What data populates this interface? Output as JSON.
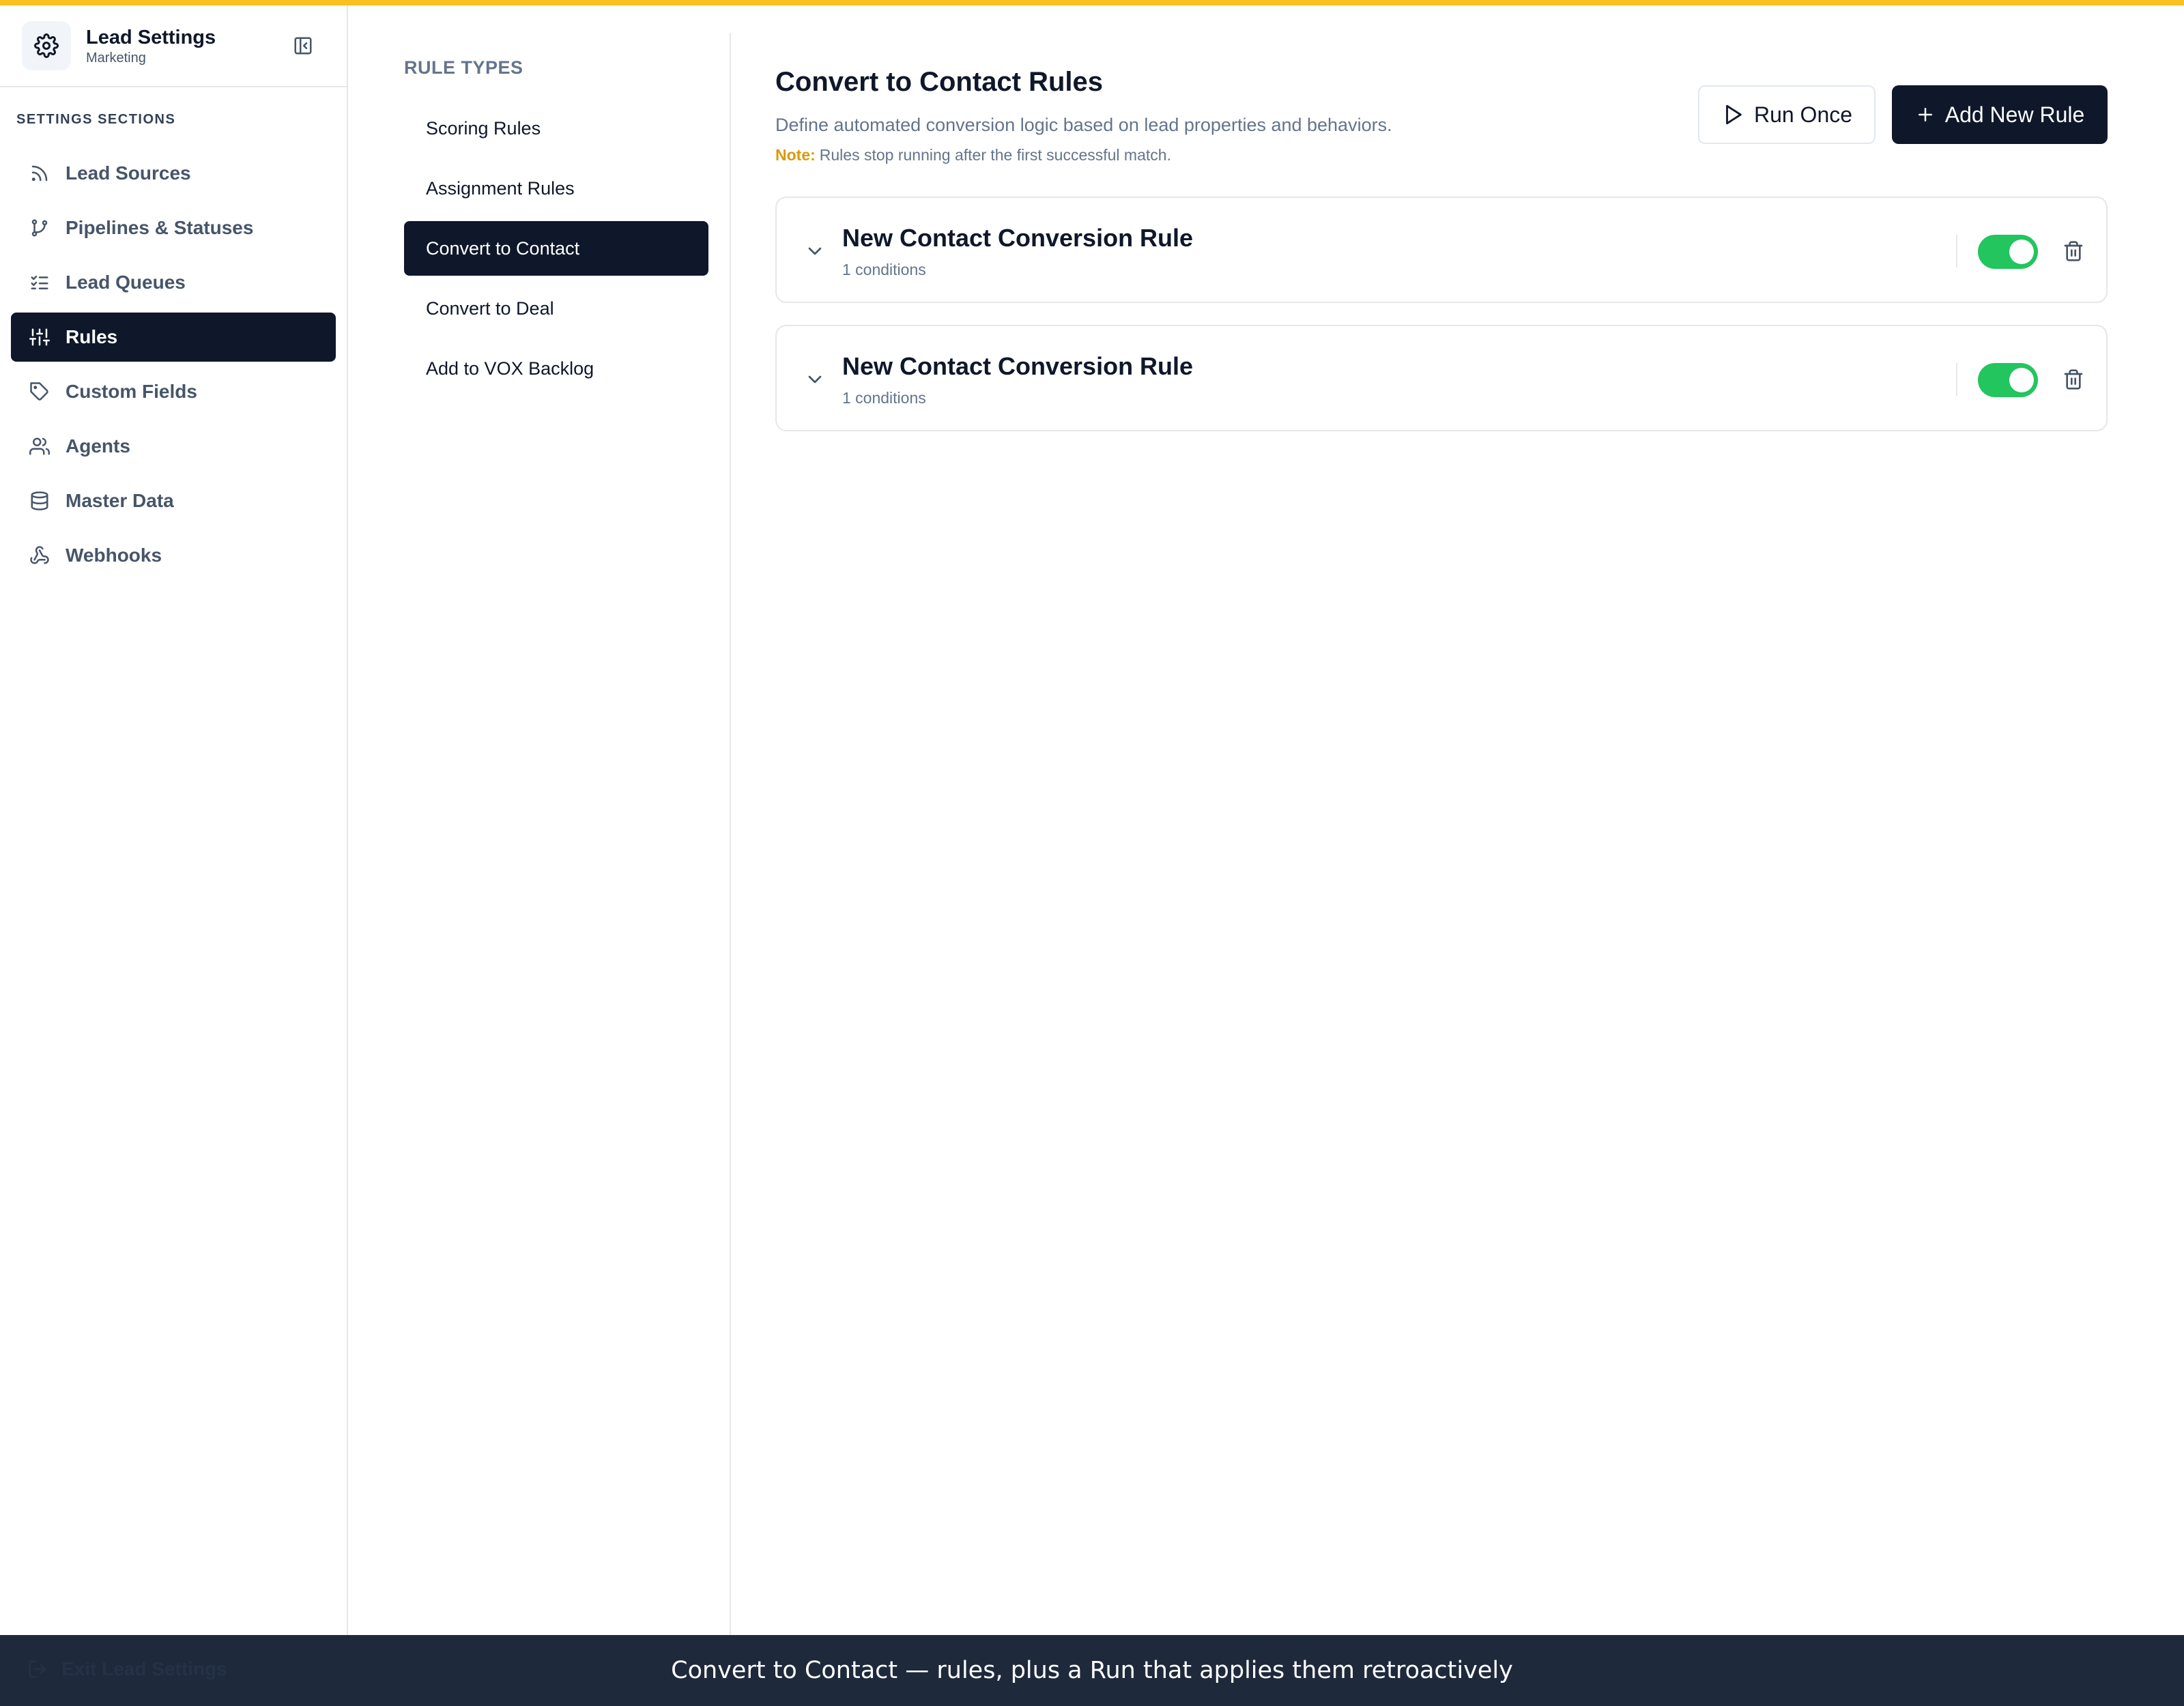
{
  "app": {
    "title": "Lead Settings",
    "subtitle": "Marketing"
  },
  "sidebar": {
    "section_label": "SETTINGS SECTIONS",
    "items": [
      {
        "label": "Lead Sources",
        "icon": "rss-icon"
      },
      {
        "label": "Pipelines & Statuses",
        "icon": "git-branch-icon"
      },
      {
        "label": "Lead Queues",
        "icon": "list-checks-icon"
      },
      {
        "label": "Rules",
        "icon": "sliders-icon",
        "active": true
      },
      {
        "label": "Custom Fields",
        "icon": "tag-icon"
      },
      {
        "label": "Agents",
        "icon": "users-icon"
      },
      {
        "label": "Master Data",
        "icon": "database-icon"
      },
      {
        "label": "Webhooks",
        "icon": "webhook-icon"
      }
    ],
    "exit_label": "Exit Lead Settings"
  },
  "rule_types": {
    "label": "RULE TYPES",
    "items": [
      {
        "label": "Scoring Rules"
      },
      {
        "label": "Assignment Rules"
      },
      {
        "label": "Convert to Contact",
        "active": true
      },
      {
        "label": "Convert to Deal"
      },
      {
        "label": "Add to VOX Backlog"
      }
    ]
  },
  "main": {
    "title": "Convert to Contact Rules",
    "description": "Define automated conversion logic based on lead properties and behaviors.",
    "note_label": "Note:",
    "note_text": "Rules stop running after the first successful match.",
    "run_once_label": "Run Once",
    "add_rule_label": "Add New Rule",
    "rules": [
      {
        "name": "New Contact Conversion Rule",
        "conditions": "1 conditions",
        "enabled": true
      },
      {
        "name": "New Contact Conversion Rule",
        "conditions": "1 conditions",
        "enabled": true
      }
    ]
  },
  "caption": "Convert to Contact — rules, plus a Run that applies them retroactively",
  "colors": {
    "accent_bar": "#fbbf24",
    "primary_dark": "#0f172a",
    "toggle_on": "#22c55e",
    "note_label": "#d99a0b",
    "caption_bar": "#1e293b"
  }
}
